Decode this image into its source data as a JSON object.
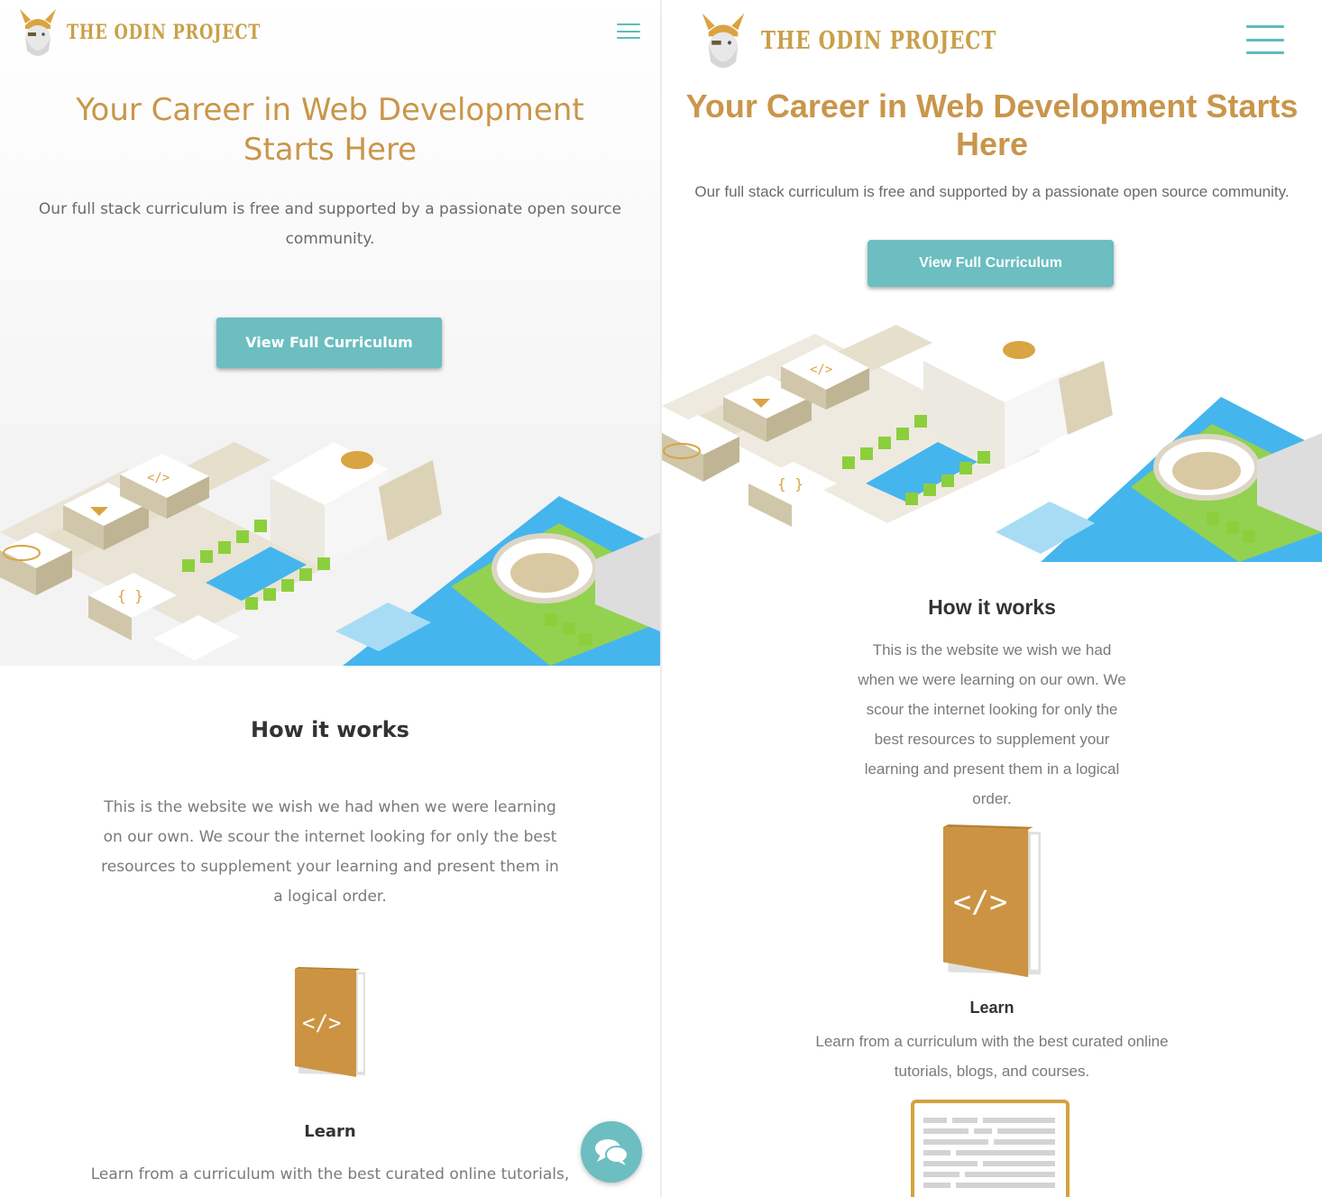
{
  "brand": {
    "name": "THE ODIN PROJECT"
  },
  "hero": {
    "title": "Your Career in Web Development Starts Here",
    "subtitle": "Our full stack curriculum is free and supported by a passionate open source community.",
    "cta_label": "View Full Curriculum"
  },
  "how_it_works": {
    "heading": "How it works",
    "body": "This is the website we wish we had when we were learning on our own. We scour the internet looking for only the best resources to supplement your learning and present them in a logical order."
  },
  "features": [
    {
      "title": "Learn",
      "text": "Learn from a curriculum with the best curated online tutorials, blogs, and courses.",
      "icon": "code-book-icon"
    }
  ],
  "left_pane": {
    "feature_text_visible": "Learn from a curriculum with the best curated online tutorials,"
  },
  "icons": {
    "menu": "hamburger-menu-icon",
    "chat": "chat-bubbles-icon",
    "logo": "odin-viking-logo-icon",
    "article": "article-page-icon"
  },
  "colors": {
    "accent_gold": "#c9964a",
    "accent_teal": "#6cbec0",
    "text_gray": "#6a6a6a",
    "heading_dark": "#333333"
  }
}
